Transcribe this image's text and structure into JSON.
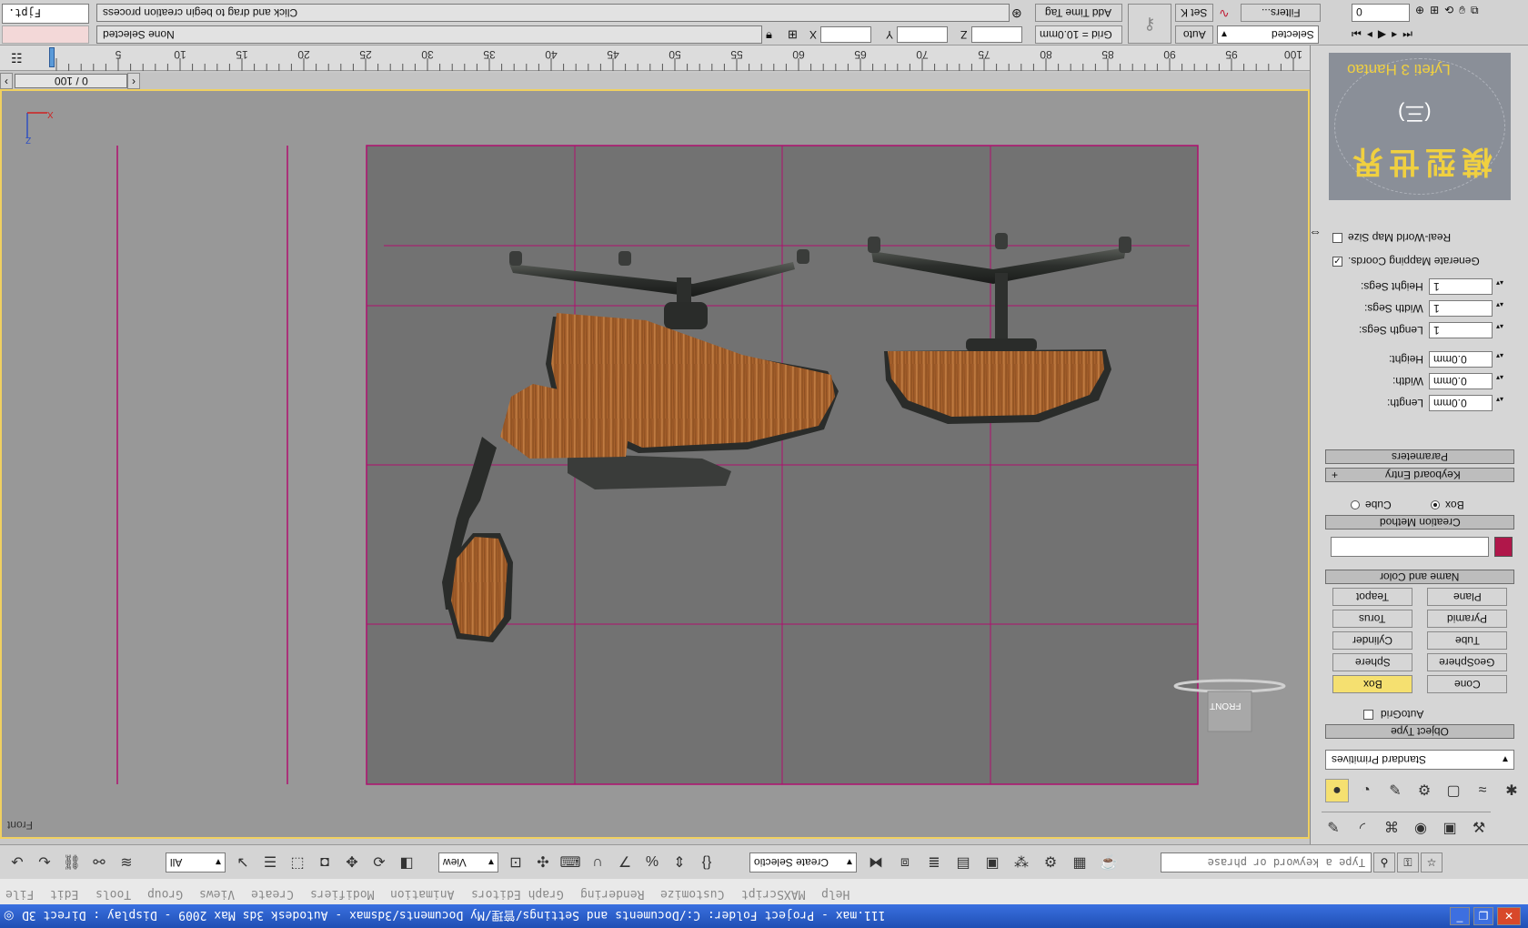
{
  "window": {
    "title": "111.max - Project Folder: C:/Documents and Settings/管理/My Documents/3dsmax - Autodesk 3ds Max 2009 - Display : Direct 3D",
    "minimize_icon": "minimize-icon",
    "maximize_icon": "maximize-icon",
    "close_icon": "close-icon"
  },
  "menu": {
    "items": [
      "File",
      "Edit",
      "Tools",
      "Group",
      "Views",
      "Create",
      "Modifiers",
      "Animation",
      "Graph Editors",
      "Rendering",
      "Customize",
      "MAXScript",
      "Help"
    ]
  },
  "search": {
    "placeholder": "Type a keyword or phrase"
  },
  "main_toolbar": {
    "selection_filter": "All",
    "reference_coord": "View",
    "named_selection": "Create Selectio"
  },
  "status": {
    "script_listener": "Fjpt.",
    "selection_status": "None Selected",
    "prompt": "Click and drag to begin creation process",
    "x_label": "X",
    "y_label": "Y",
    "z_label": "Z",
    "x_value": "",
    "y_value": "",
    "z_value": "",
    "grid": "Grid = 10.0mm",
    "add_time_tag": "Add Time Tag",
    "auto_key": "Auto",
    "set_key": "Set K",
    "key_filter_select": "Selected",
    "key_filters": "Filters...",
    "frame_field": "0"
  },
  "timeline": {
    "slider_label": "0 / 100",
    "ticks": [
      "5",
      "10",
      "15",
      "20",
      "25",
      "30",
      "35",
      "40",
      "45",
      "50",
      "55",
      "60",
      "65",
      "70",
      "75",
      "80",
      "85",
      "90",
      "95",
      "100"
    ]
  },
  "viewport": {
    "label": "Front",
    "axis_x": "X",
    "axis_z": "Z",
    "viewcube_label": "FRONT"
  },
  "command_panel": {
    "logo_title": "Lyfeti 3 Hantao",
    "logo_sub": "(三)",
    "logo_big": "模型世界",
    "category": "Standard Primitives",
    "rollouts": {
      "object_type": "Object Type",
      "name_color": "Name and Color",
      "creation_method": "Creation Method",
      "keyboard_entry": "Keyboard Entry",
      "parameters": "Parameters"
    },
    "autogrid": "AutoGrid",
    "object_buttons": [
      [
        "Box",
        "Cone"
      ],
      [
        "Sphere",
        "GeoSphere"
      ],
      [
        "Cylinder",
        "Tube"
      ],
      [
        "Torus",
        "Pyramid"
      ],
      [
        "Teapot",
        "Plane"
      ]
    ],
    "creation_cube": "Cube",
    "creation_box": "Box",
    "params": {
      "length_label": "Length:",
      "length_value": "0.0mm",
      "width_label": "Width:",
      "width_value": "0.0mm",
      "height_label": "Height:",
      "height_value": "0.0mm",
      "length_segs_label": "Length Segs:",
      "length_segs_value": "1",
      "width_segs_label": "Width Segs:",
      "width_segs_value": "1",
      "height_segs_label": "Height Segs:",
      "height_segs_value": "1",
      "gen_mapping": "Generate Mapping Coords.",
      "real_world": "Real-World Map Size"
    },
    "swatch_color": "#b0174a"
  },
  "colors": {
    "viewport_bg": "#989898",
    "safe_frame_bg": "#727272",
    "grid_line": "#b0106f",
    "accent_yellow": "#f5e070",
    "title_bar": "#2f5fc8"
  }
}
